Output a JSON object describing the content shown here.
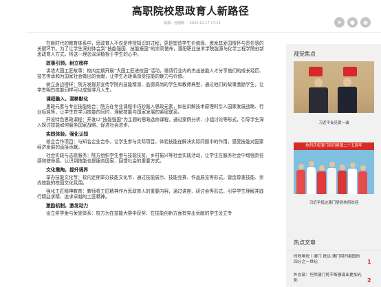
{
  "article": {
    "title": "高职院校思政育人新路径",
    "source": "来源：光明网",
    "date": "2024-12-17 17:14",
    "blocks": [
      {
        "type": "p",
        "text": "在新时代的教育体系中，思政育人不仅是传授知识的过程，更是塑造学生价值观、激发其爱国情怀与责任感的关键环节。为了让学生深刻体会到“技能强国、技能报国”的崇高使命，濮阳职业技术学院能源与化学工程学院创新思政育人方式，将这一理念深深植根于学生的心中。"
      },
      {
        "type": "h",
        "text": "故事引领，树立榜样"
      },
      {
        "type": "p",
        "text": "讲述大国工匠故事：校内定期开展“大国工匠进校园”活动，邀请行业内的杰出技能人才分享他们的成长经历、技艺传承和为国家社会做出的贡献，让学生近距离感受技能的魅力与价值。"
      },
      {
        "type": "p",
        "text": "树立身边榜样：院方发掘并宣传学院内技能精湛、品德高尚的学生和教师典型，通过他们的故事激励学生，让学生明白技能同样可以成就非凡人生。"
      },
      {
        "type": "h",
        "text": "课程融入，潜移默化"
      },
      {
        "type": "p",
        "text": "思政元素与专业技能结合：院方在专业课程中巧妙融入思政元素，如在讲解技术原理时引入国家发展战略、行业标准等，让学生在学习技能的同时，理解技能与国家发展的紧密联系。"
      },
      {
        "type": "p",
        "text": "开设特色思政课程：开发以“技能强国”为主题的思政选修课程，通过案例分析、小组讨论等形式，引导学生深入探讨技能如何服务国家战略、促进社会进步。"
      },
      {
        "type": "h",
        "text": "实践体验，强化认知"
      },
      {
        "type": "p",
        "text": "校企合作项目：与知名企业合作，让学生参与实际项目，体验技能在解决实际问题中的作用，感受技能对国家经济发展的直接贡献。"
      },
      {
        "type": "p",
        "text": "社会实践与志愿服务：院方组织学生参与技能扶贫、乡村振兴等社会实践活动，让学生在服务社会中增强责任感和使命感，认识到技能也是服务国家、回馈社会的重要方式。"
      },
      {
        "type": "h",
        "text": "文化熏陶，提升境界"
      },
      {
        "type": "p",
        "text": "举办技能文化节：校内定期举办技能文化节，通过技能展示、技能竞赛、作品展览等形式，营造尊重技能、崇尚技能的校园文化氛围。"
      },
      {
        "type": "p",
        "text": "强化工匠精神教育：教师将工匠精神作为思政育人的重要内容，通过讲座、研讨会等形式，引导学生理解并践行精益求精、追求卓越的工匠精神。"
      },
      {
        "type": "h",
        "text": "激励机制，激发动力"
      },
      {
        "type": "p",
        "text": "设立奖学金与荣誉体系：校方为在技能大赛中获奖、在技能创新方面有突出贡献的学生设立专"
      }
    ]
  },
  "share_icons": [
    "star-icon",
    "wechat-icon",
    "weibo-icon"
  ],
  "sidebar": {
    "focus_heading": "视觉焦点",
    "focus_items": [
      {
        "caption": "习近平会见贺一诚"
      },
      {
        "caption": "习近平抵达澳门受到热烈欢迎",
        "banner": "热烈庆祝澳门回归祖国二十五周年"
      }
    ],
    "latest_heading": "热点文章",
    "latest_items": [
      {
        "text": "时政画说丨澳门 抵达 澳门回归祖国的四分之一世纪",
        "rank": "1"
      },
      {
        "text": "外交部：坦然澳门将不断展现出更加光彩",
        "rank": "2"
      }
    ]
  },
  "colors": {
    "accent": "#d42a2a",
    "sidebar_bg": "#f1f1f1"
  }
}
